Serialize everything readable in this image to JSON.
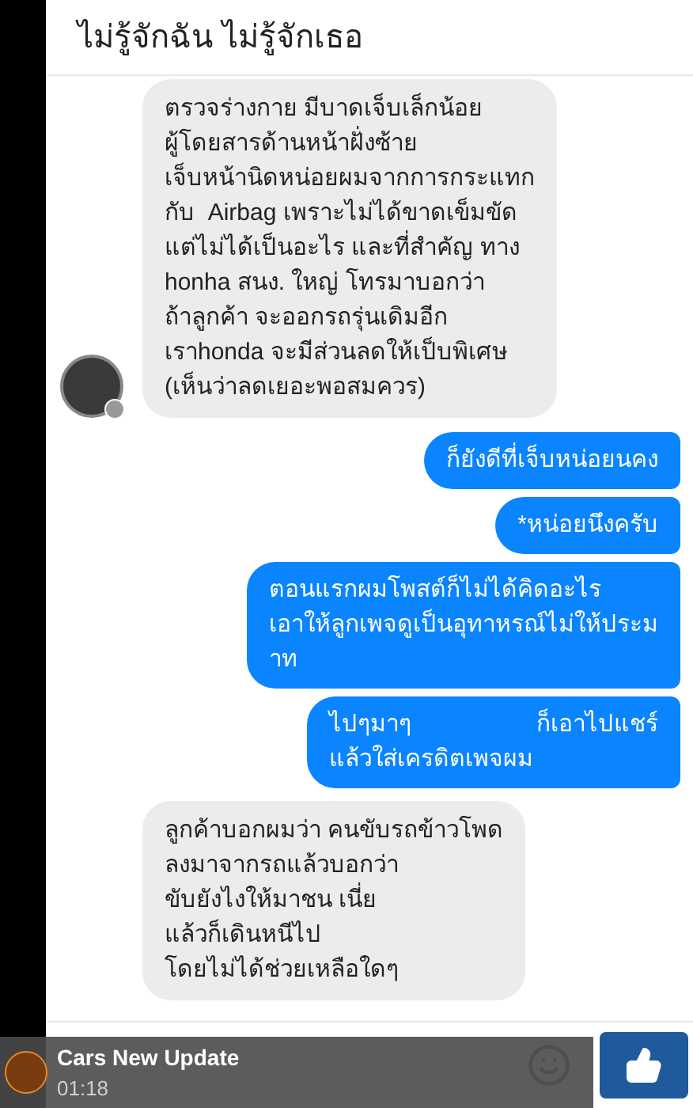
{
  "header": {
    "title": "ไม่รู้จักฉัน ไม่รู้จักเธอ"
  },
  "messages": [
    {
      "kind": "received",
      "avatar": true,
      "text": "ตรวจร่างกาย มีบาดเจ็บเล็กน้อย\nผู้โดยสารด้านหน้าฝั่งซ้าย\nเจ็บหน้านิดหน่อยผมจากการกระแทก\nกับ  Airbag เพราะไม่ได้ขาดเข็มขัด\nแต่ไม่ได้เป็นอะไร และที่สำคัญ ทาง\nhonha สนง. ใหญ่ โทรมาบอกว่า\nถ้าลูกค้า จะออกรถรุ่นเดิมอีก\nเราhonda จะมีส่วนลดให้เป็บพิเศษ\n(เห็นว่าลดเยอะพอสมควร)"
    },
    {
      "kind": "sent",
      "avatar": false,
      "text": "ก็ยังดีที่เจ็บหน่อยนคง"
    },
    {
      "kind": "sent",
      "avatar": false,
      "text": "*หน่อยนึงครับ"
    },
    {
      "kind": "sent",
      "avatar": false,
      "text": "ตอนแรกผมโพสต์ก็ไม่ได้คิดอะไร\nเอาให้ลูกเพจดูเป็นอุทาหรณ์ไม่ให้ประม\nาท"
    },
    {
      "kind": "sent",
      "avatar": false,
      "text": "ไปๆมาๆ                   ก็เอาไปแชร์\nแล้วใส่เครดิตเพจผม"
    },
    {
      "kind": "received",
      "avatar": false,
      "text": "ลูกค้าบอกผมว่า คนขับรถข้าวโพด\nลงมาจากรถแล้วบอกว่า\nขับยังไงให้มาชน เนี่ย\nแล้วก็เดินหนีไป\nโดยไม่ได้ช่วยเหลือใดๆ"
    }
  ],
  "notification": {
    "title": "Cars New Update",
    "time": "01:18"
  }
}
